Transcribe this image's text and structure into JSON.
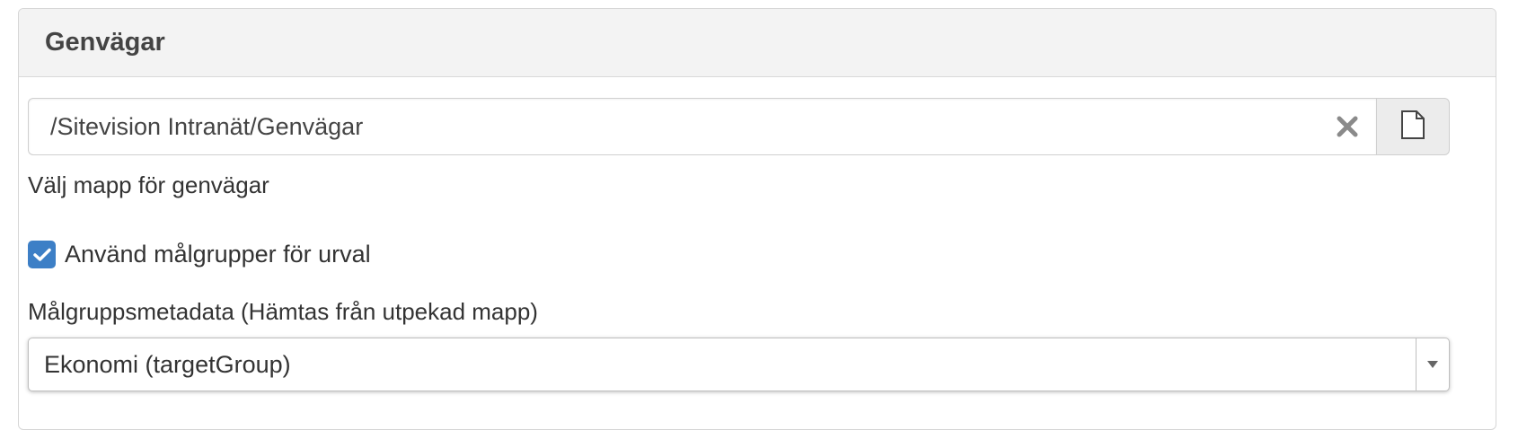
{
  "panel": {
    "title": "Genvägar"
  },
  "folder_picker": {
    "value": "/Sitevision Intranät/Genvägar",
    "help_text": "Välj mapp för genvägar",
    "clear_icon": "close-icon",
    "browse_icon": "file-icon"
  },
  "target_group_checkbox": {
    "label": "Använd målgrupper för urval",
    "checked": true
  },
  "metadata_select": {
    "label": "Målgruppsmetadata (Hämtas från utpekad mapp)",
    "selected": "Ekonomi (targetGroup)"
  },
  "colors": {
    "accent": "#3d7fc6",
    "header_bg": "#f3f3f3",
    "text": "#333333"
  }
}
